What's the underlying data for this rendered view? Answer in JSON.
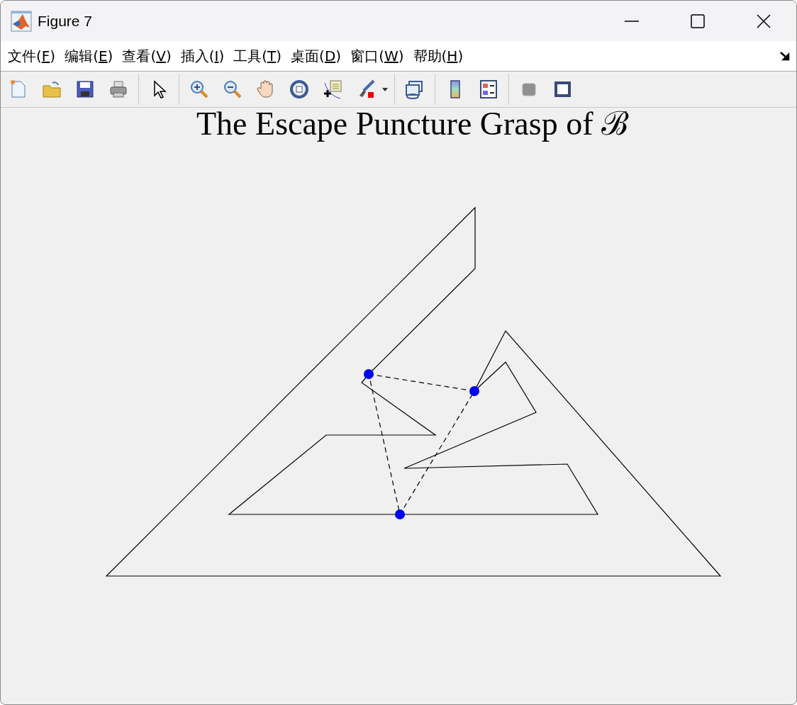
{
  "window": {
    "title": "Figure 7"
  },
  "menu": [
    "文件(F)",
    "编辑(E)",
    "查看(V)",
    "插入(I)",
    "工具(T)",
    "桌面(D)",
    "窗口(W)",
    "帮助(H)"
  ],
  "figure": {
    "title": "The Escape Puncture Grasp of ℬ"
  }
}
